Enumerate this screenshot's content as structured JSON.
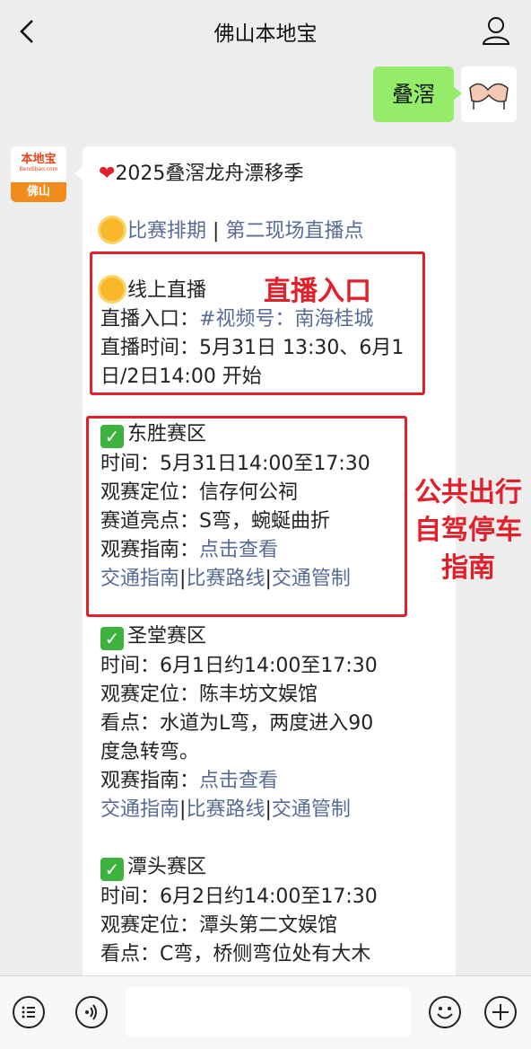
{
  "header": {
    "title": "佛山本地宝"
  },
  "outgoing": {
    "text": "叠滘"
  },
  "bot_avatar": {
    "brand": "本地宝",
    "sub": "Bendibao.com",
    "city": "佛山"
  },
  "article": {
    "heading": "2025叠滘龙舟漂移季",
    "schedule_link": "比赛排期",
    "sep": "|",
    "live_link": "第二现场直播点",
    "online": {
      "title": "线上直播",
      "entry_label": "直播入口：",
      "entry_link": "#视频号：南海桂城",
      "time_line1": "直播时间：5月31日 13:30、6月1",
      "time_line2": "日/2日14:00 开始"
    },
    "dongsheng": {
      "title": "东胜赛区",
      "time": "时间：5月31日14:00至17:30",
      "location": "观赛定位：信存何公祠",
      "highlight": "赛道亮点：S弯，蜿蜒曲折",
      "guide_label": "观赛指南：",
      "guide_link": "点击查看",
      "links": [
        "交通指南",
        "比赛路线",
        "交通管制"
      ]
    },
    "shengtang": {
      "title": "圣堂赛区",
      "time": "时间：6月1日约14:00至17:30",
      "location": "观赛定位：陈丰坊文娱馆",
      "highlight1": "看点：水道为L弯，两度进入90",
      "highlight2": "度急转弯。",
      "guide_label": "观赛指南：",
      "guide_link": "点击查看",
      "links": [
        "交通指南",
        "比赛路线",
        "交通管制"
      ]
    },
    "tantou": {
      "title": "潭头赛区",
      "time": "时间：6月2日约14:00至17:30",
      "location": "观赛定位：潭头第二文娱馆",
      "highlight1": "看点：C弯，桥侧弯位处有大木"
    }
  },
  "annotations": {
    "live_entry": "直播入口",
    "transport_1": "公共出行",
    "transport_2": "自驾停车",
    "transport_3": "指南"
  },
  "colors": {
    "link": "#576b95",
    "red": "#e0202b",
    "bubble_green": "#95ec69"
  }
}
